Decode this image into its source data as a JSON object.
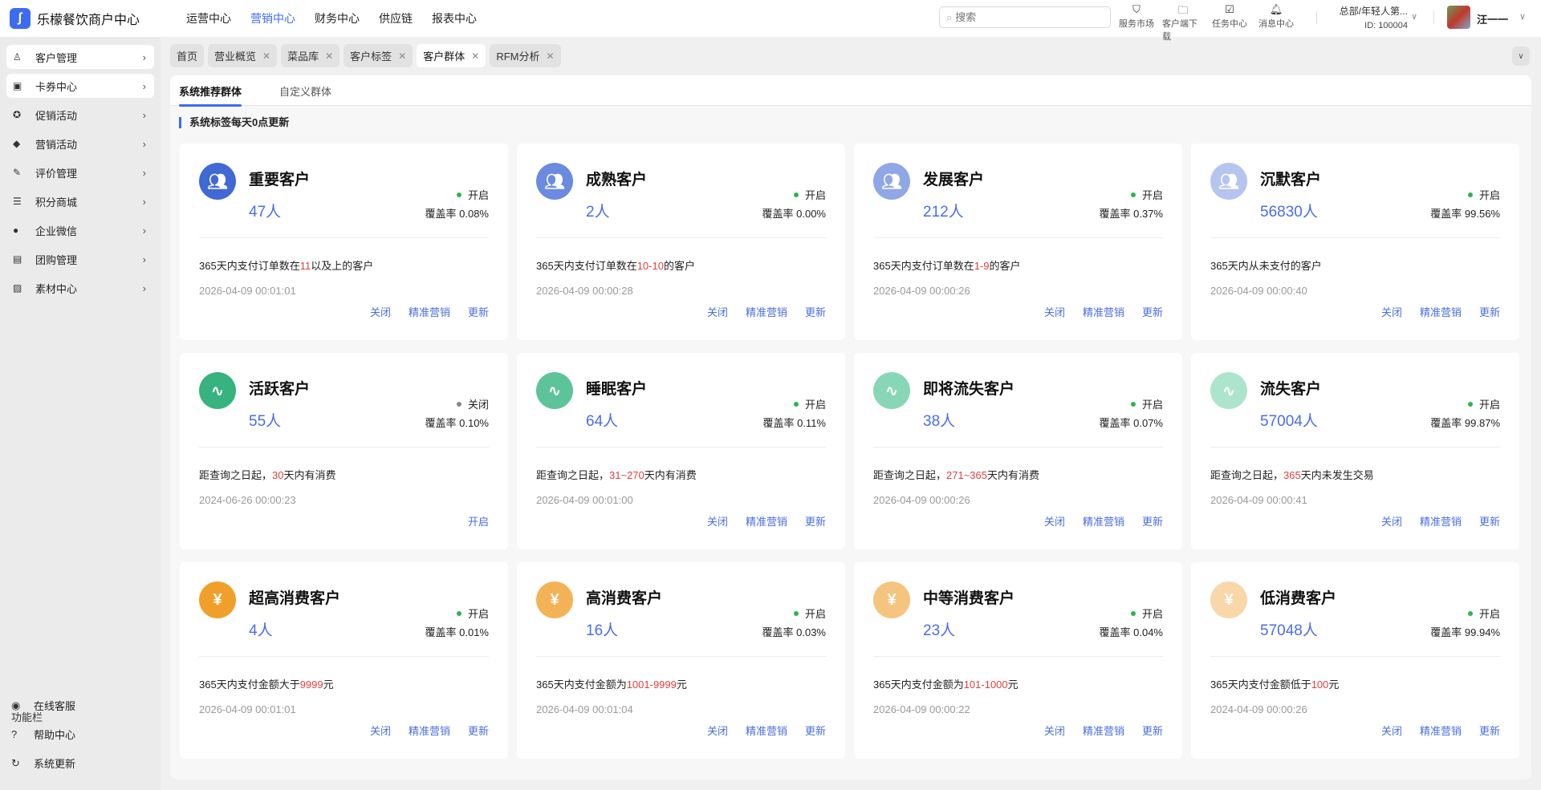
{
  "app": {
    "title": "乐檬餐饮商户中心"
  },
  "topnav": [
    "运营中心",
    "营销中心",
    "财务中心",
    "供应链",
    "报表中心"
  ],
  "topnav_active": 1,
  "search": {
    "placeholder": "搜索"
  },
  "tools": [
    {
      "label": "服务市场",
      "icon": "shop-bag-icon"
    },
    {
      "label": "客户端下载",
      "icon": "folder-download-icon"
    },
    {
      "label": "任务中心",
      "icon": "clipboard-check-icon"
    },
    {
      "label": "消息中心",
      "icon": "bell-icon"
    }
  ],
  "org": {
    "name": "总部/年轻人第...",
    "id": "ID: 100004"
  },
  "user": {
    "name": "汪一一"
  },
  "sidebar": {
    "items": [
      {
        "label": "客户管理",
        "icon": "user-icon"
      },
      {
        "label": "卡券中心",
        "icon": "coupon-icon"
      },
      {
        "label": "促销活动",
        "icon": "discount-badge-icon"
      },
      {
        "label": "营销活动",
        "icon": "tag-icon"
      },
      {
        "label": "评价管理",
        "icon": "edit-check-icon"
      },
      {
        "label": "积分商城",
        "icon": "database-icon"
      },
      {
        "label": "企业微信",
        "icon": "wechat-icon"
      },
      {
        "label": "团购管理",
        "icon": "gift-icon"
      },
      {
        "label": "素材中心",
        "icon": "image-icon"
      }
    ],
    "func_title": "功能栏",
    "func_items": [
      {
        "label": "在线客服",
        "icon": "headset-icon"
      },
      {
        "label": "帮助中心",
        "icon": "help-icon"
      },
      {
        "label": "系统更新",
        "icon": "refresh-icon"
      }
    ]
  },
  "tabs": [
    {
      "label": "首页",
      "closable": false
    },
    {
      "label": "营业概览",
      "closable": true
    },
    {
      "label": "菜品库",
      "closable": true
    },
    {
      "label": "客户标签",
      "closable": true
    },
    {
      "label": "客户群体",
      "closable": true,
      "active": true
    },
    {
      "label": "RFM分析",
      "closable": true
    }
  ],
  "subtabs": [
    "系统推荐群体",
    "自定义群体"
  ],
  "section_label": "系统标签每天0点更新",
  "labels": {
    "coverage": "覆盖率",
    "on": "开启",
    "off": "关闭",
    "close": "关闭",
    "precise": "精准营销",
    "update": "更新",
    "open": "开启"
  },
  "colors": {
    "accent": "#3d6bf0",
    "on": "#2fb350",
    "off": "#888888",
    "highlight": "#e04040"
  },
  "cards": [
    {
      "title": "重要客户",
      "count": "47人",
      "status": "开启",
      "coverage": "0.08%",
      "desc_pre": "365天内支付订单数在",
      "desc_hl": "11",
      "desc_post": "以及上的客户",
      "date": "2026-04-09 00:01:01",
      "icon": "users-icon",
      "color": "#4169d3",
      "actions": [
        "关闭",
        "精准营销",
        "更新"
      ]
    },
    {
      "title": "成熟客户",
      "count": "2人",
      "status": "开启",
      "coverage": "0.00%",
      "desc_pre": "365天内支付订单数在",
      "desc_hl": "10-10",
      "desc_post": "的客户",
      "date": "2026-04-09 00:00:28",
      "icon": "users-icon",
      "color": "#6b8be0",
      "actions": [
        "关闭",
        "精准营销",
        "更新"
      ]
    },
    {
      "title": "发展客户",
      "count": "212人",
      "status": "开启",
      "coverage": "0.37%",
      "desc_pre": "365天内支付订单数在",
      "desc_hl": "1-9",
      "desc_post": "的客户",
      "date": "2026-04-09 00:00:26",
      "icon": "users-icon",
      "color": "#8fa7e6",
      "actions": [
        "关闭",
        "精准营销",
        "更新"
      ]
    },
    {
      "title": "沉默客户",
      "count": "56830人",
      "status": "开启",
      "coverage": "99.56%",
      "desc_pre": "365天内从未支付的客户",
      "desc_hl": "",
      "desc_post": "",
      "date": "2026-04-09 00:00:40",
      "icon": "users-icon",
      "color": "#b5c5ef",
      "actions": [
        "关闭",
        "精准营销",
        "更新"
      ]
    },
    {
      "title": "活跃客户",
      "count": "55人",
      "status": "关闭",
      "coverage": "0.10%",
      "desc_pre": "距查询之日起，",
      "desc_hl": "30",
      "desc_post": "天内有消费",
      "date": "2024-06-26 00:00:23",
      "icon": "activity-icon",
      "color": "#36b37e",
      "actions": [
        "开启"
      ]
    },
    {
      "title": "睡眠客户",
      "count": "64人",
      "status": "开启",
      "coverage": "0.11%",
      "desc_pre": "距查询之日起，",
      "desc_hl": "31~270",
      "desc_post": "天内有消费",
      "date": "2026-04-09 00:01:00",
      "icon": "activity-icon",
      "color": "#5cc498",
      "actions": [
        "关闭",
        "精准营销",
        "更新"
      ]
    },
    {
      "title": "即将流失客户",
      "count": "38人",
      "status": "开启",
      "coverage": "0.07%",
      "desc_pre": "距查询之日起，",
      "desc_hl": "271~365",
      "desc_post": "天内有消费",
      "date": "2026-04-09 00:00:26",
      "icon": "activity-icon",
      "color": "#87d6b5",
      "actions": [
        "关闭",
        "精准营销",
        "更新"
      ]
    },
    {
      "title": "流失客户",
      "count": "57004人",
      "status": "开启",
      "coverage": "99.87%",
      "desc_pre": "距查询之日起，",
      "desc_hl": "365",
      "desc_post": "天内未发生交易",
      "date": "2026-04-09 00:00:41",
      "icon": "activity-icon",
      "color": "#ade4cc",
      "actions": [
        "关闭",
        "精准营销",
        "更新"
      ]
    },
    {
      "title": "超高消费客户",
      "count": "4人",
      "status": "开启",
      "coverage": "0.01%",
      "desc_pre": "365天内支付金额大于",
      "desc_hl": "9999",
      "desc_post": "元",
      "date": "2026-04-09 00:01:01",
      "icon": "yen-icon",
      "color": "#f0a02a",
      "actions": [
        "关闭",
        "精准营销",
        "更新"
      ]
    },
    {
      "title": "高消费客户",
      "count": "16人",
      "status": "开启",
      "coverage": "0.03%",
      "desc_pre": "365天内支付金额为",
      "desc_hl": "1001-9999",
      "desc_post": "元",
      "date": "2026-04-09 00:01:04",
      "icon": "yen-icon",
      "color": "#f3b256",
      "actions": [
        "关闭",
        "精准营销",
        "更新"
      ]
    },
    {
      "title": "中等消费客户",
      "count": "23人",
      "status": "开启",
      "coverage": "0.04%",
      "desc_pre": "365天内支付金额为",
      "desc_hl": "101-1000",
      "desc_post": "元",
      "date": "2026-04-09 00:00:22",
      "icon": "yen-icon",
      "color": "#f5c47f",
      "actions": [
        "关闭",
        "精准营销",
        "更新"
      ]
    },
    {
      "title": "低消费客户",
      "count": "57048人",
      "status": "开启",
      "coverage": "99.94%",
      "desc_pre": "365天内支付金额低于",
      "desc_hl": "100",
      "desc_post": "元",
      "date": "2024-04-09 00:00:26",
      "icon": "yen-icon",
      "color": "#f8d7a9",
      "actions": [
        "关闭",
        "精准营销",
        "更新"
      ]
    }
  ]
}
